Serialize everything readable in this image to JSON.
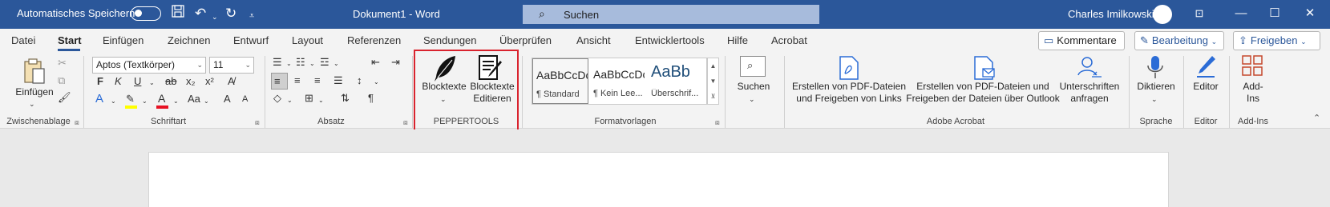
{
  "titlebar": {
    "autosave_label": "Automatisches Speichern",
    "doc_title": "Dokument1  -  Word",
    "search_placeholder": "Suchen",
    "user_name": "Charles Imilkowski",
    "save_icon": "save-icon",
    "undo_icon": "undo-icon",
    "redo_icon": "redo-icon"
  },
  "tabs": [
    "Datei",
    "Start",
    "Einfügen",
    "Zeichnen",
    "Entwurf",
    "Layout",
    "Referenzen",
    "Sendungen",
    "Überprüfen",
    "Ansicht",
    "Entwicklertools",
    "Hilfe",
    "Acrobat"
  ],
  "active_tab": "Start",
  "header_buttons": {
    "comments": "Kommentare",
    "editing": "Bearbeitung",
    "share": "Freigeben"
  },
  "ribbon": {
    "clipboard": {
      "paste": "Einfügen",
      "label": "Zwischenablage"
    },
    "font": {
      "font_name": "Aptos (Textkörper)",
      "font_size": "11",
      "label": "Schriftart",
      "bold": "F",
      "italic": "K",
      "underline": "U",
      "strike": "ab",
      "subscript": "x₂",
      "superscript": "x²",
      "text_effect": "A",
      "font_color": "A",
      "change_case": "Aa",
      "grow": "A",
      "shrink": "A"
    },
    "paragraph": {
      "label": "Absatz",
      "pilcrow": "¶"
    },
    "peppertools": {
      "blocktexte": "Blocktexte",
      "blocktexte_edit": "Blocktexte\nEditieren",
      "label": "PEPPERTOOLS"
    },
    "styles": {
      "label": "Formatvorlagen",
      "items": [
        {
          "sample": "AaBbCcDc",
          "name": "¶ Standard"
        },
        {
          "sample": "AaBbCcDc",
          "name": "¶ Kein Lee..."
        },
        {
          "sample": "AaBb",
          "name": "Überschrif..."
        }
      ]
    },
    "search": {
      "label": "Suchen"
    },
    "acrobat": {
      "label": "Adobe Acrobat",
      "create_share_links": "Erstellen von PDF-Dateien\nund Freigeben von Links",
      "create_share_outlook": "Erstellen von PDF-Dateien und\nFreigeben der Dateien über Outlook",
      "request_signatures": "Unterschriften\nanfragen"
    },
    "speech": {
      "dictate": "Diktieren",
      "label": "Sprache"
    },
    "editor": {
      "editor": "Editor",
      "label": "Editor"
    },
    "addins": {
      "addins": "Add-\nIns",
      "label": "Add-Ins"
    }
  },
  "colors": {
    "titlebar": "#2b579a",
    "highlight_yellow": "#ffff00",
    "font_red": "#e81123",
    "callout_red": "#d9232e"
  }
}
